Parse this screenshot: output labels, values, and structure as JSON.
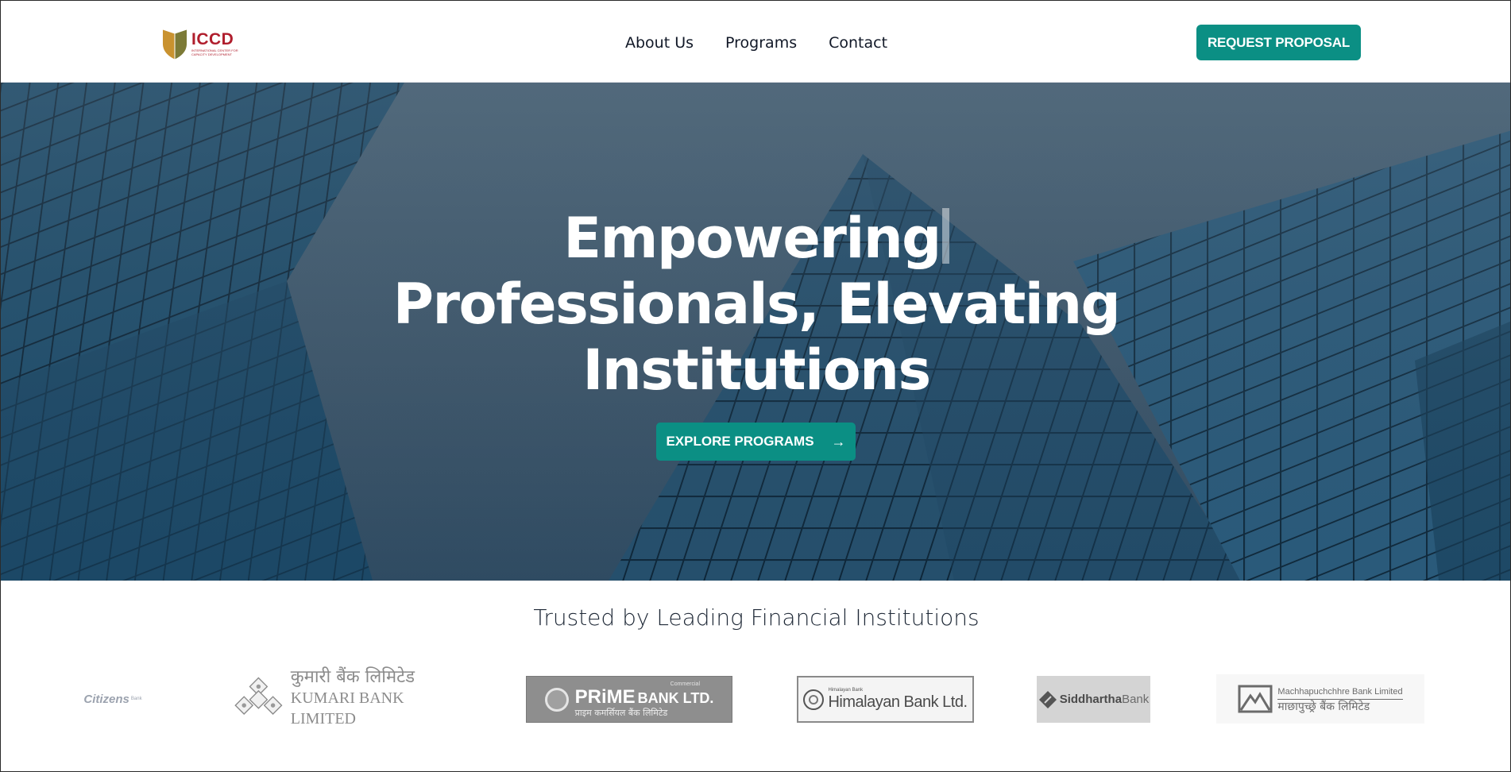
{
  "brand": {
    "name": "ICCD",
    "subtitle": "INTERNATIONAL CENTER FOR CAPACITY DEVELOPMENT",
    "colors": {
      "primary": "#0b8f84",
      "logo_red": "#b01e2d",
      "logo_gold": "#c9922f",
      "logo_olive": "#7c7a36"
    }
  },
  "nav": {
    "items": [
      "About Us",
      "Programs",
      "Contact"
    ]
  },
  "header": {
    "cta_label": "REQUEST PROPOSAL"
  },
  "hero": {
    "title_line1": "Empowering",
    "title_line2": "Professionals, Elevating",
    "title_line3": "Institutions",
    "button_label": "EXPLORE PROGRAMS",
    "button_icon": "arrow-right-icon"
  },
  "trusted": {
    "title": "Trusted by Leading Financial Institutions",
    "banks": [
      {
        "name": "Citizens",
        "suffix": "Bank"
      },
      {
        "name": "कुमारी बैंक लिमिटेड",
        "subname": "KUMARI BANK LIMITED"
      },
      {
        "name": "PRiME",
        "suffix": "BANK LTD.",
        "tag": "Commercial",
        "subname": "प्राइम कमर्सियल बैंक लिमिटेड"
      },
      {
        "name": "Himalayan Bank Ltd.",
        "tag": "Himalayan Bank"
      },
      {
        "name": "Siddhartha",
        "suffix": "Bank"
      },
      {
        "name": "Machhapuchchhre Bank Limited",
        "subname": "माछापुच्छ्रे बैंक लिमिटेड"
      }
    ]
  }
}
